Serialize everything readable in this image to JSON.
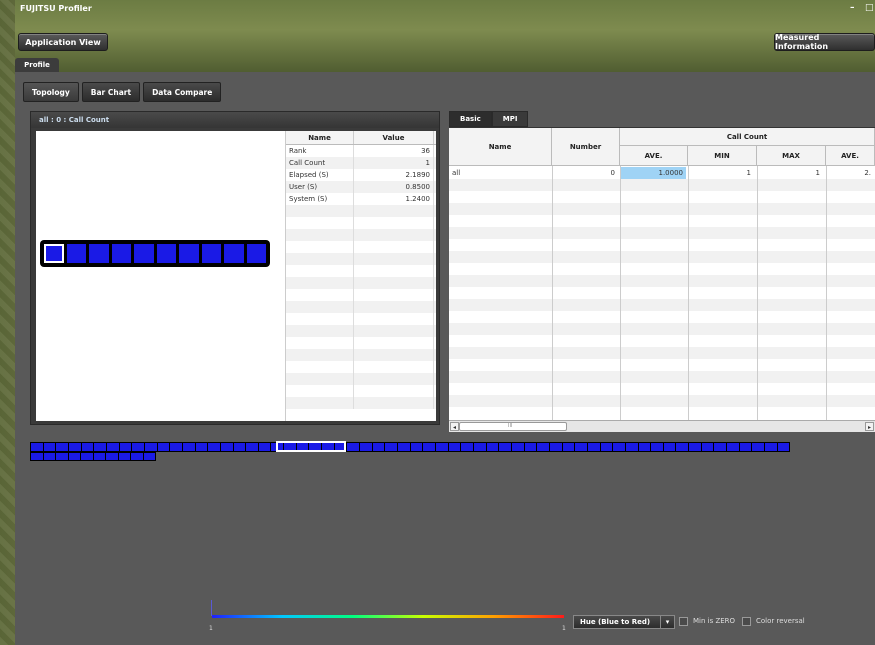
{
  "window": {
    "title": "FUJITSU Profiler",
    "controls": [
      "–",
      "□"
    ]
  },
  "header": {
    "app_view_button": "Application View",
    "measured_info_button": "Measured Information",
    "profile_tab": "Profile"
  },
  "subtabs": [
    "Topology",
    "Bar Chart",
    "Data Compare"
  ],
  "left_panel": {
    "title": "all : 0 : Call Count",
    "table": {
      "headers": [
        "Name",
        "Value"
      ],
      "rows": [
        {
          "name": "Rank",
          "value": "36"
        },
        {
          "name": "Call Count",
          "value": "1"
        },
        {
          "name": "Elapsed (S)",
          "value": "2.1890"
        },
        {
          "name": "User (S)",
          "value": "0.8500"
        },
        {
          "name": "System (S)",
          "value": "1.2400"
        }
      ]
    }
  },
  "right_panel": {
    "tabs": [
      "Basic",
      "MPI"
    ],
    "headers": {
      "name": "Name",
      "number": "Number",
      "group": "Call Count",
      "ave": "AVE.",
      "min": "MIN",
      "max": "MAX",
      "ave2": "AVE."
    },
    "rows": [
      {
        "name": "all",
        "number": "0",
        "ave": "1.0000",
        "min": "1",
        "max": "1",
        "ave2": "2."
      }
    ],
    "scrollbar": {
      "left": "◂",
      "right": "▸",
      "grip": "III"
    }
  },
  "legend": {
    "min_label": "1",
    "max_label": "1",
    "color_mode": "Hue (Blue to Red)",
    "dropdown_arrow": "▾",
    "min_is_zero_label": "Min is ZERO",
    "color_reversal_label": "Color reversal",
    "colors": {
      "start": "#2020ff",
      "end": "#ff1a1a"
    }
  }
}
